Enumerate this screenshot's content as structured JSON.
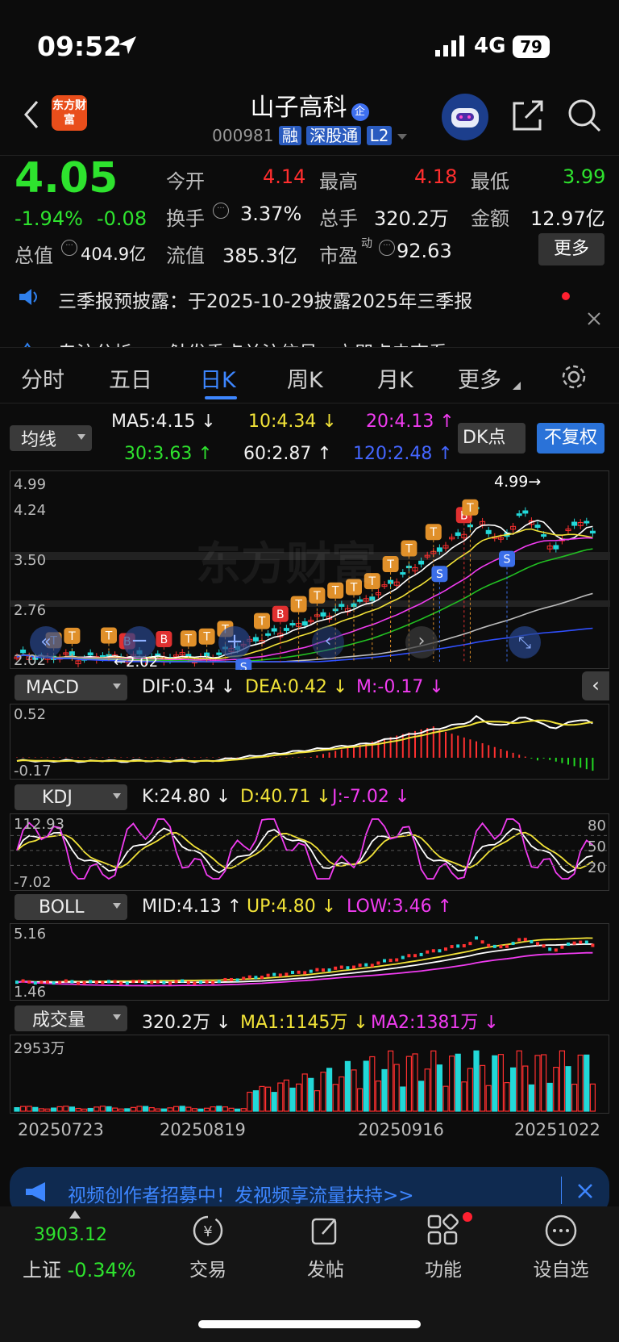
{
  "status": {
    "time": "09:52",
    "network": "4G",
    "battery": "79"
  },
  "stock": {
    "name": "山子高科",
    "code": "000981",
    "tags": [
      "融",
      "深股通",
      "L2"
    ],
    "logo_text": "东方财富",
    "name_badge": "企"
  },
  "quote": {
    "price": "4.05",
    "change_pct": "-1.94%",
    "change": "-0.08",
    "open_label": "今开",
    "open": "4.14",
    "high_label": "最高",
    "high": "4.18",
    "low_label": "最低",
    "low": "3.99",
    "turnover_label": "换手",
    "turnover": "3.37%",
    "volume_label": "总手",
    "volume": "320.2万",
    "amount_label": "金额",
    "amount": "12.97亿",
    "mcap_label": "总值",
    "mcap": "404.9亿",
    "float_label": "流值",
    "float_mcap": "385.3亿",
    "pe_label": "市盈",
    "pe_sup": "动",
    "pe": "92.63",
    "more_button": "更多"
  },
  "notices": [
    "三季报预披露：于2025-10-29披露2025年三季报",
    "专注分析：…触发重点关注信号，立即点击查看"
  ],
  "tabs": [
    "分时",
    "五日",
    "日K",
    "周K",
    "月K",
    "更多"
  ],
  "active_tab": "日K",
  "ma": {
    "selector": "均线",
    "ma5": "MA5:4.15",
    "ma10": "10:4.34",
    "ma20": "20:4.13",
    "ma30": "30:3.63",
    "ma60": "60:2.87",
    "ma120": "120:2.48",
    "dk_button": "DK点",
    "fq_button": "不复权"
  },
  "kline": {
    "y_labels": [
      "4.99",
      "4.24",
      "3.50",
      "2.76",
      "2.02"
    ],
    "peak_label": "4.99",
    "low_label": "2.02",
    "watermark": "东方财富"
  },
  "macd": {
    "name": "MACD",
    "dif": "DIF:0.34",
    "dea": "DEA:0.42",
    "m": "M:-0.17",
    "y_top": "0.52",
    "y_bottom": "-0.17"
  },
  "kdj": {
    "name": "KDJ",
    "k": "K:24.80",
    "d": "D:40.71",
    "j": "J:-7.02",
    "y_top": "112.93",
    "y_bottom": "-7.02",
    "levels": [
      "80",
      "50",
      "20"
    ]
  },
  "boll": {
    "name": "BOLL",
    "mid": "MID:4.13",
    "up": "UP:4.80",
    "low": "LOW:3.46",
    "y_top": "5.16",
    "y_bottom": "1.46"
  },
  "vol": {
    "name": "成交量",
    "cur": "320.2万",
    "ma1": "MA1:1145万",
    "ma2": "MA2:1381万",
    "y_top": "2953万"
  },
  "dates": [
    "20250723",
    "20250819",
    "20250916",
    "20251022"
  ],
  "banner": {
    "text": "视频创作者招募中！发视频享流量扶持>>"
  },
  "index": {
    "value": "3903.12",
    "name": "上证",
    "change": "-0.34%"
  },
  "bottom_nav": [
    "交易",
    "发帖",
    "功能",
    "设自选"
  ],
  "chart_data": {
    "type": "candlestick",
    "dates": [
      "20250723",
      "20250819",
      "20250916",
      "20251022"
    ],
    "ylim": [
      2.02,
      4.99
    ],
    "series": [
      {
        "name": "MA5",
        "last": 4.15
      },
      {
        "name": "MA10",
        "last": 4.34
      },
      {
        "name": "MA20",
        "last": 4.13
      },
      {
        "name": "MA30",
        "last": 3.63
      },
      {
        "name": "MA60",
        "last": 2.87
      },
      {
        "name": "MA120",
        "last": 2.48
      }
    ]
  }
}
